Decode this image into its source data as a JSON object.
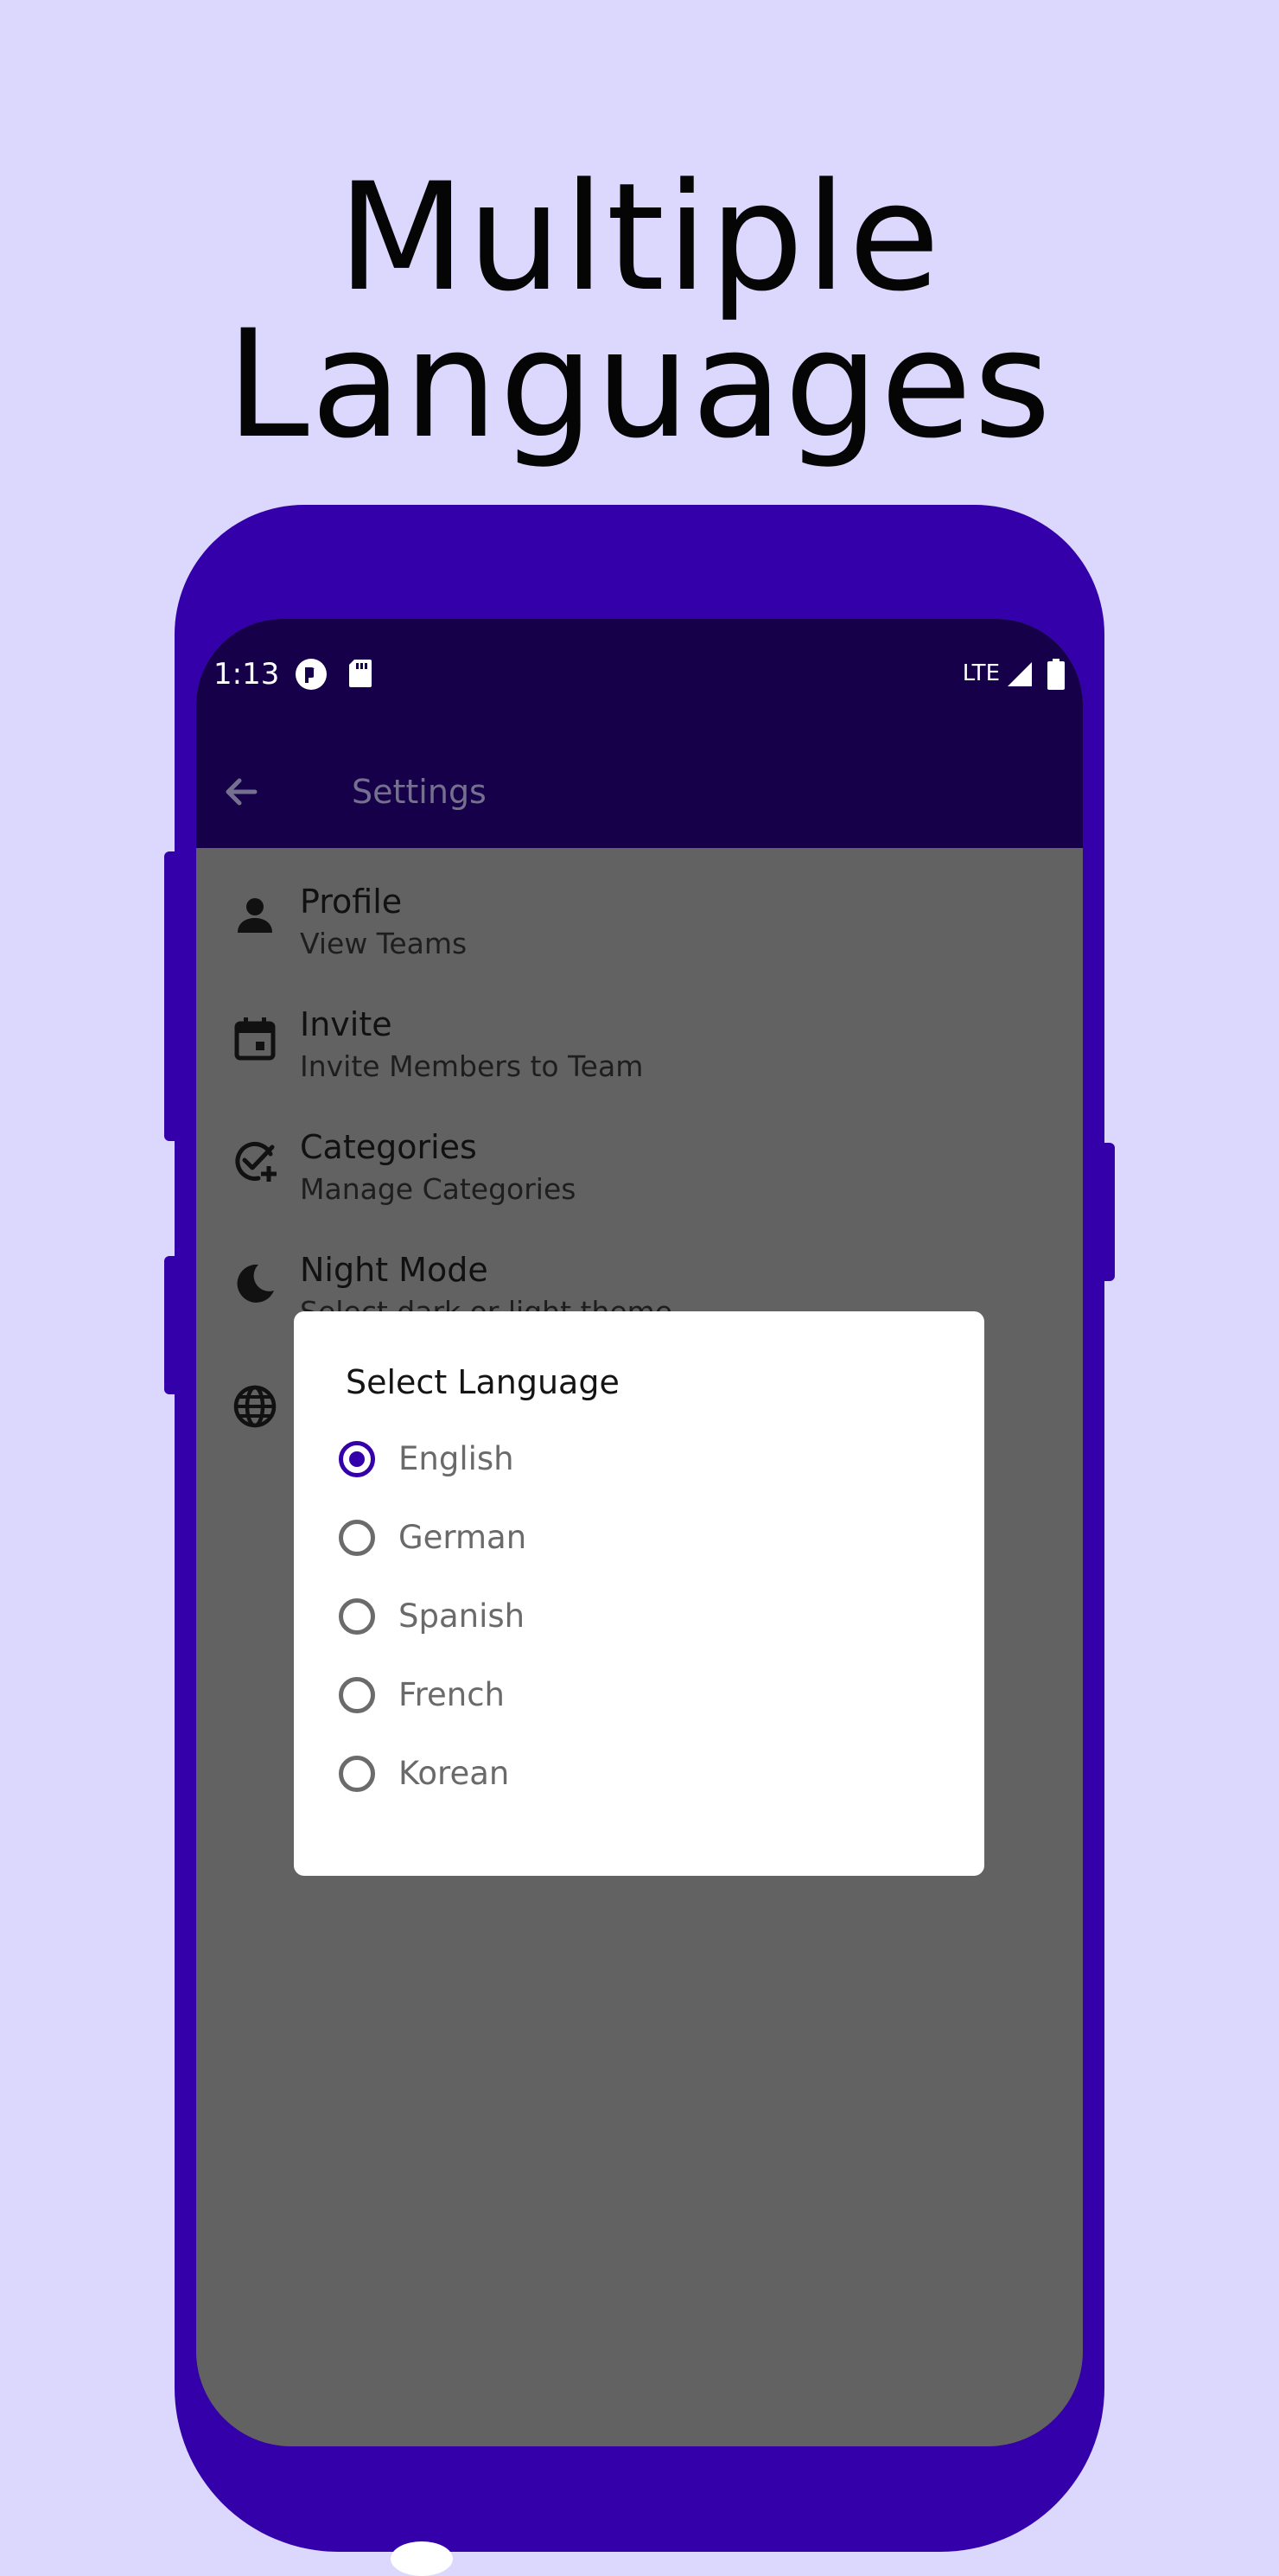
{
  "headline": {
    "line1": "Multiple",
    "line2": "Languages"
  },
  "colors": {
    "background": "#dcd8fd",
    "phone_body": "#3300aa",
    "app_bar": "#16004a",
    "scrim": "#626262",
    "accent": "#3300aa"
  },
  "status_bar": {
    "time": "1:13",
    "network": "LTE",
    "icons": [
      "app-notification-icon",
      "sd-card-icon",
      "signal-icon",
      "battery-icon"
    ]
  },
  "app_bar": {
    "title": "Settings",
    "back_icon": "arrow-left-icon"
  },
  "settings": [
    {
      "title": "Profile",
      "subtitle": "View Teams",
      "icon": "person-icon"
    },
    {
      "title": "Invite",
      "subtitle": "Invite Members to Team",
      "icon": "calendar-icon"
    },
    {
      "title": "Categories",
      "subtitle": "Manage Categories",
      "icon": "check-add-icon"
    },
    {
      "title": "Night Mode",
      "subtitle": "Select dark or light theme",
      "icon": "moon-icon"
    },
    {
      "title": "",
      "subtitle": "",
      "icon": "globe-icon"
    }
  ],
  "dialog": {
    "title": "Select Language",
    "selected": "English",
    "options": [
      "English",
      "German",
      "Spanish",
      "French",
      "Korean"
    ]
  }
}
